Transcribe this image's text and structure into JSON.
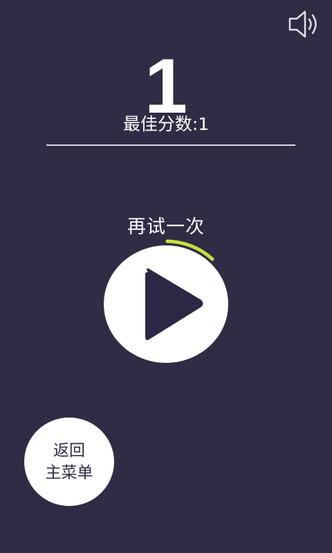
{
  "hud": {
    "sound_icon": "speaker-icon",
    "score": "1",
    "best_score_label": "最佳分数:1"
  },
  "retry": {
    "label": "再试一次",
    "play_icon": "play-icon",
    "countdown_remaining_fraction": 0.12
  },
  "menu": {
    "line1": "返回",
    "line2": "主菜单"
  },
  "colors": {
    "background": "#2f2d45",
    "foreground": "#ffffff",
    "accent": "#c6e23a",
    "play_triangle": "#2a2844"
  }
}
